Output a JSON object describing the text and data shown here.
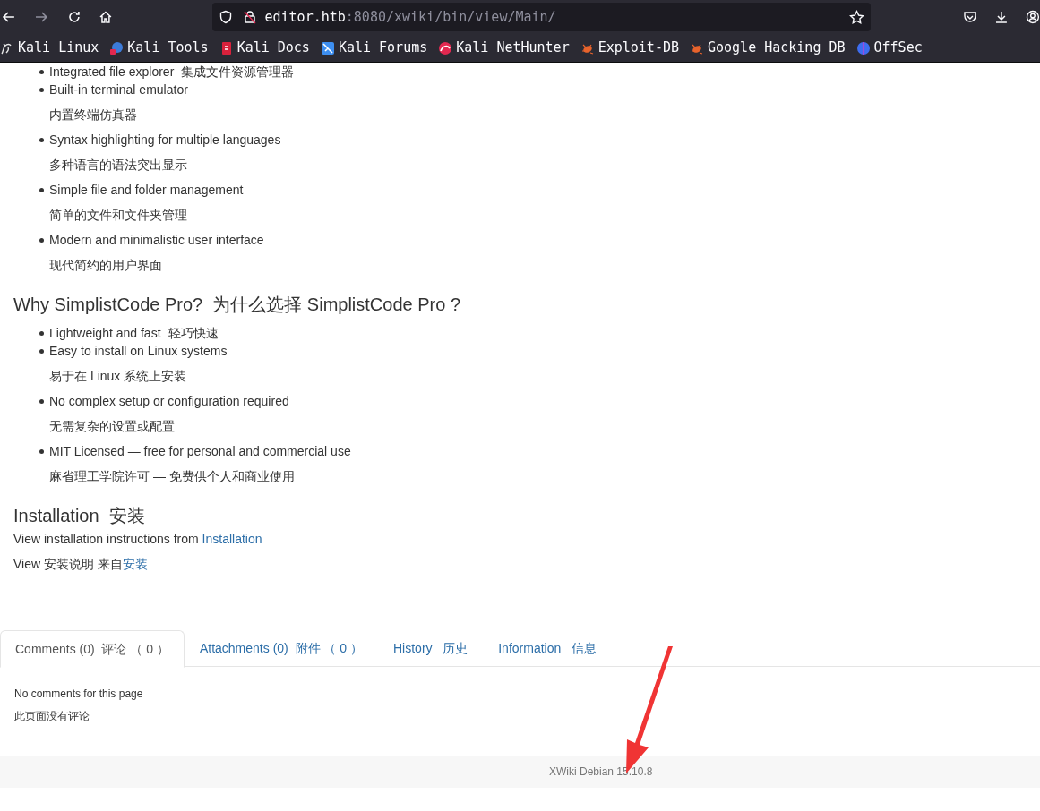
{
  "browser": {
    "url_host": "editor.htb",
    "url_rest": ":8080/xwiki/bin/view/Main/",
    "bookmarks": [
      {
        "label": "Kali Linux",
        "kind": "dragon"
      },
      {
        "label": "Kali Tools",
        "kind": "tools"
      },
      {
        "label": "Kali Docs",
        "kind": "docs"
      },
      {
        "label": "Kali Forums",
        "kind": "forums"
      },
      {
        "label": "Kali NetHunter",
        "kind": "nethunter"
      },
      {
        "label": "Exploit-DB",
        "kind": "bug"
      },
      {
        "label": "Google Hacking DB",
        "kind": "bug"
      },
      {
        "label": "OffSec",
        "kind": "offsec"
      }
    ]
  },
  "features": [
    {
      "text": "Integrated file explorer",
      "translation": "集成文件资源管理器",
      "kind": "inline"
    },
    {
      "text": "Built-in terminal emulator",
      "translation": "内置终端仿真器",
      "kind": "block"
    },
    {
      "text": "Syntax highlighting for multiple languages",
      "translation": "多种语言的语法突出显示",
      "kind": "block"
    },
    {
      "text": "Simple file and folder management",
      "translation": "简单的文件和文件夹管理",
      "kind": "block"
    },
    {
      "text": "Modern and minimalistic user interface",
      "translation": "现代简约的用户界面",
      "kind": "block"
    }
  ],
  "why": {
    "heading": "Why SimplistCode Pro?  为什么选择 SimplistCode Pro ?",
    "items": [
      {
        "text": "Lightweight and fast",
        "translation": "轻巧快速",
        "kind": "inline"
      },
      {
        "text": "Easy to install on Linux systems",
        "translation": "易于在 Linux 系统上安装",
        "kind": "block"
      },
      {
        "text": "No complex setup or configuration required",
        "translation": "无需复杂的设置或配置",
        "kind": "block"
      },
      {
        "text": "MIT Licensed — free for personal and commercial use",
        "translation": "麻省理工学院许可 — 免费供个人和商业使用",
        "kind": "block"
      }
    ]
  },
  "installation": {
    "heading": "Installation  安装",
    "lines": [
      {
        "text": "View installation instructions from ",
        "link": "Installation"
      },
      {
        "text": "View 安装说明 来自",
        "link": "安装"
      }
    ]
  },
  "tabs": [
    {
      "label": "Comments (0)  评论 （ 0 ）",
      "selected": true
    },
    {
      "label": "Attachments (0)  附件 （ 0 ）",
      "selected": false
    },
    {
      "label": "History   历史",
      "selected": false
    },
    {
      "label": "Information   信息",
      "selected": false
    }
  ],
  "comments": [
    "No comments for this page",
    "此页面没有评论"
  ],
  "footer": "XWiki Debian 15.10.8"
}
